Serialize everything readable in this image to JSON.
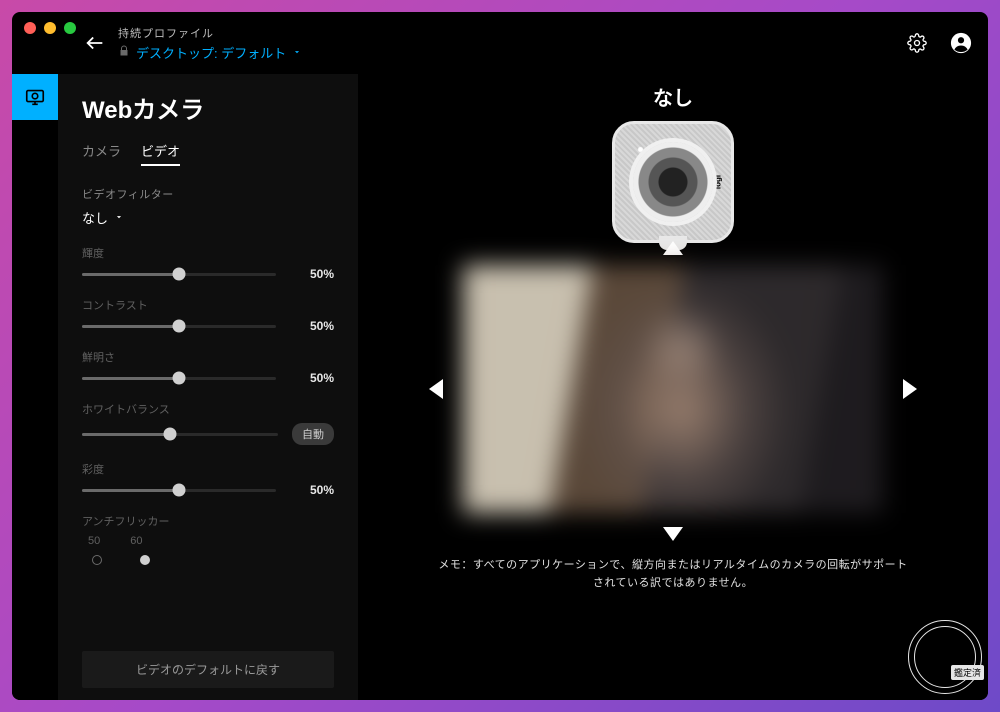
{
  "header": {
    "profile_label": "持続プロファイル",
    "profile_value": "デスクトップ: デフォルト"
  },
  "sidebar": {
    "title": "Webカメラ",
    "tabs": {
      "camera": "カメラ",
      "video": "ビデオ"
    },
    "filter_label": "ビデオフィルター",
    "filter_value": "なし",
    "sliders": {
      "brightness": {
        "label": "輝度",
        "value": 50,
        "display": "50%"
      },
      "contrast": {
        "label": "コントラスト",
        "value": 50,
        "display": "50%"
      },
      "sharpness": {
        "label": "鮮明さ",
        "value": 50,
        "display": "50%"
      },
      "whitebalance": {
        "label": "ホワイトバランス",
        "value": 45,
        "auto_label": "自動"
      },
      "saturation": {
        "label": "彩度",
        "value": 50,
        "display": "50%"
      }
    },
    "antiflicker": {
      "label": "アンチフリッカー",
      "opt50": "50",
      "opt60": "60",
      "selected": "60"
    },
    "reset_button": "ビデオのデフォルトに戻す"
  },
  "main": {
    "filter_name": "なし",
    "camera_brand": "logi",
    "note": "メモ：すべてのアプリケーションで、縦方向またはリアルタイムのカメラの回転がサポートされている訳ではありません。"
  },
  "stamp": {
    "text": "鑑定済"
  },
  "colors": {
    "accent": "#00b0ff"
  }
}
